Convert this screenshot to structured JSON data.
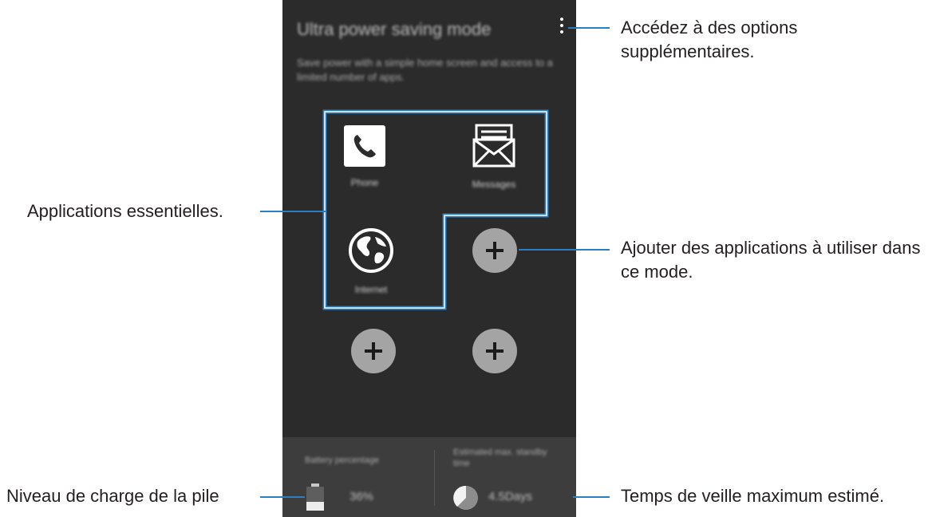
{
  "phone": {
    "title": "Ultra power saving mode",
    "description": "Save power with a simple home screen and access to a limited number of apps.",
    "apps": [
      {
        "label": "Phone",
        "icon": "phone-icon"
      },
      {
        "label": "Messages",
        "icon": "envelope-icon"
      },
      {
        "label": "Internet",
        "icon": "globe-icon"
      }
    ],
    "add_icon": "plus-icon",
    "battery": {
      "label": "Battery percentage",
      "value": "36%",
      "level": 0.36
    },
    "standby": {
      "label": "Estimated max. standby time",
      "value": "4.5Days"
    }
  },
  "callouts": {
    "more_options": "Accédez à des options supplémentaires.",
    "essential_apps": "Applications essentielles.",
    "add_apps": "Ajouter des applications à utiliser dans ce mode.",
    "battery_level": "Niveau de charge de la pile",
    "standby_time": "Temps de veille maximum estimé."
  },
  "colors": {
    "screen_background": "#2b2b2b",
    "bottom_bar": "#3d3d3d",
    "highlight_outline": "#2b7fc1",
    "callout_text": "#231f20"
  }
}
